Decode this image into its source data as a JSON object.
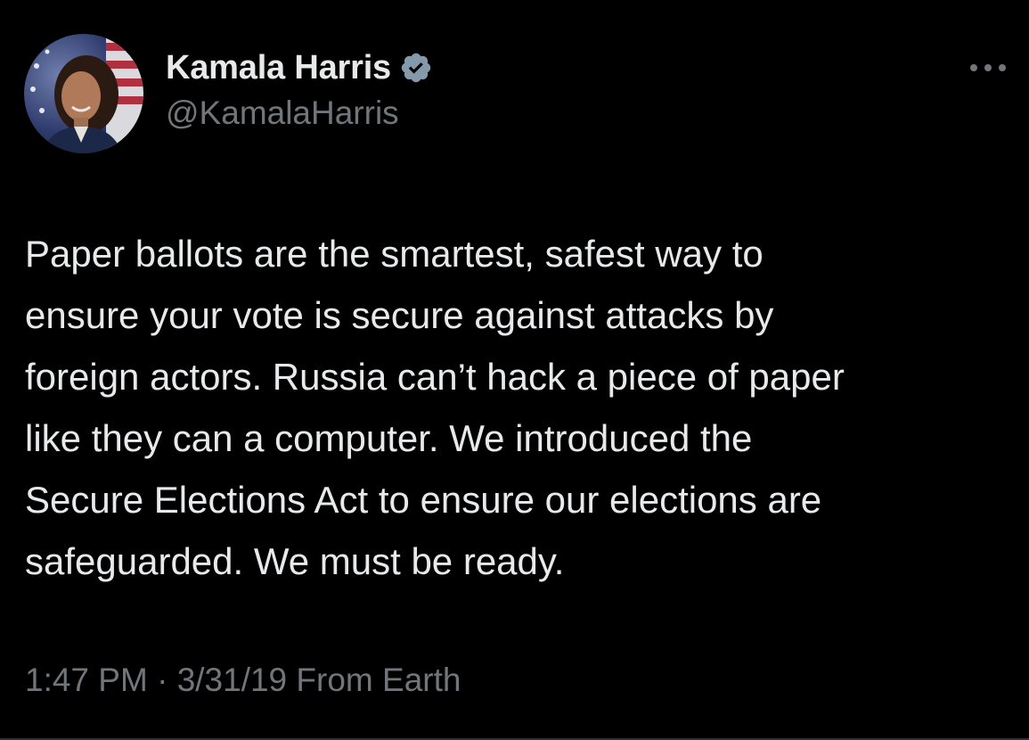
{
  "tweet": {
    "author": {
      "display_name": "Kamala Harris",
      "handle": "@KamalaHarris",
      "verified": true,
      "avatar_icon": "profile-photo"
    },
    "more_icon": "more-options-icon",
    "text_lines": [
      "Paper ballots are the smartest, safest way to",
      "ensure your vote is secure against attacks by",
      "foreign actors. Russia can’t hack a piece of paper",
      "like they can a computer. We introduced the",
      "Secure Elections Act to ensure our elections are",
      "safeguarded. We must be ready."
    ],
    "meta": {
      "time": "1:47 PM",
      "separator": " · ",
      "date": "3/31/19",
      "source": " From Earth"
    }
  },
  "colors": {
    "background": "#000000",
    "primary_text": "#e7e9ea",
    "secondary_text": "#71767b",
    "verified_badge": "#829aab"
  }
}
